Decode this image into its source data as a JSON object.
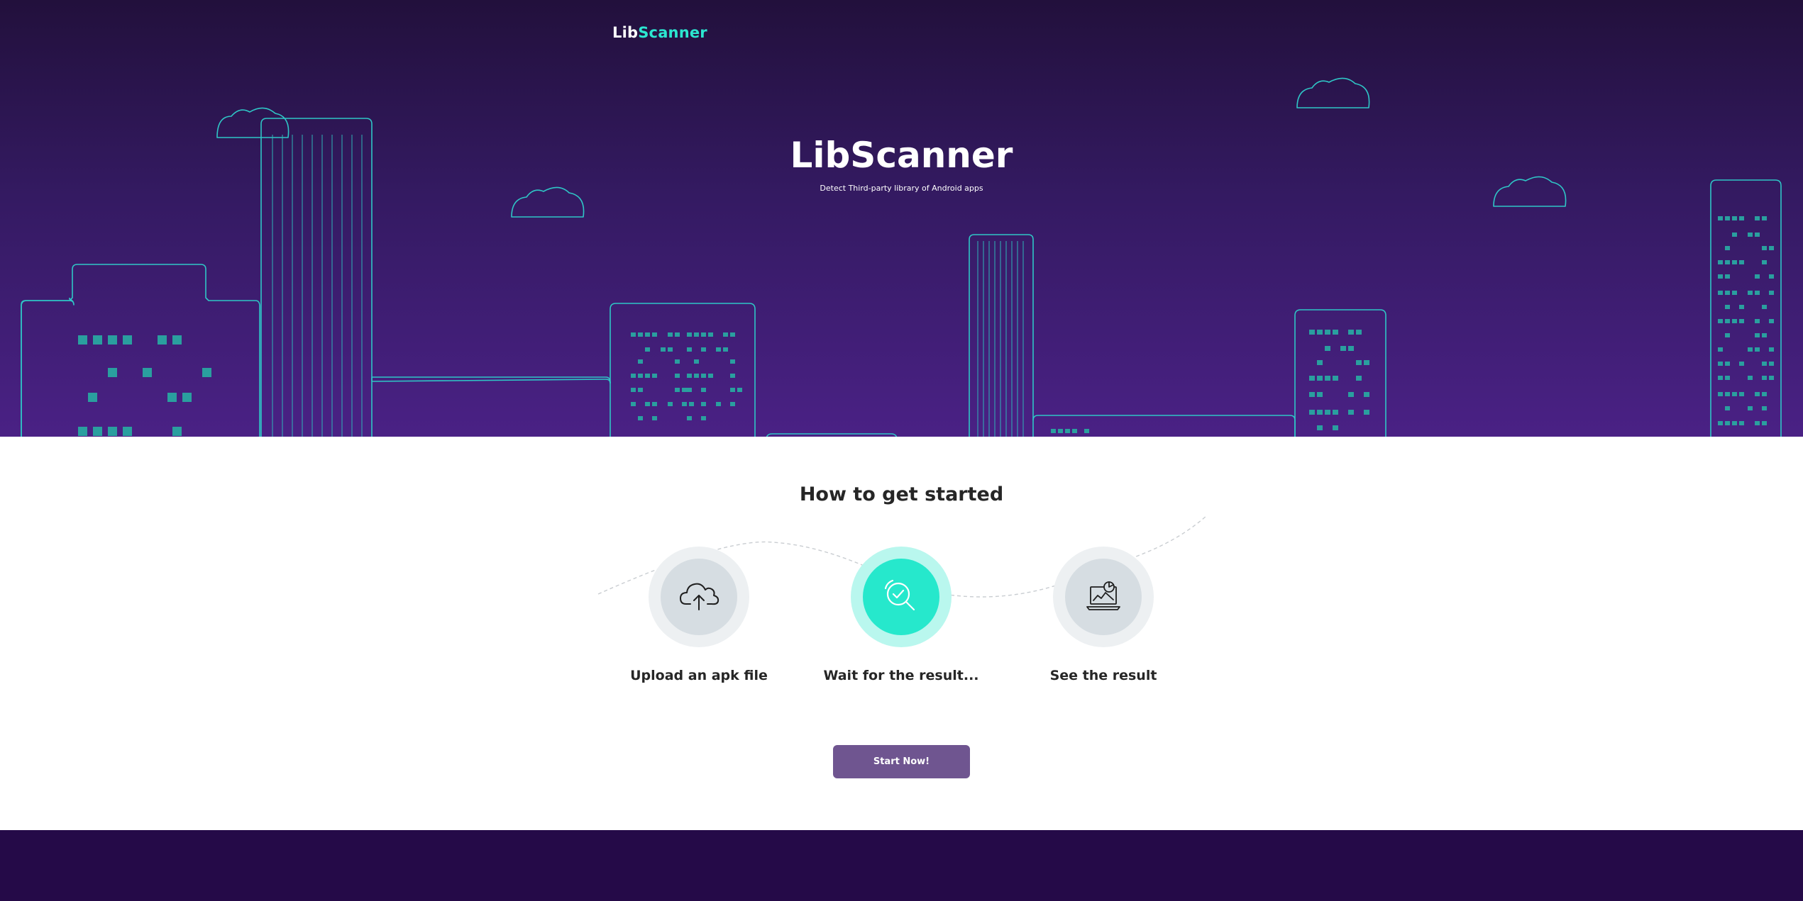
{
  "header": {
    "logo_part1": "Lib",
    "logo_part2": "Scanner"
  },
  "hero": {
    "title": "LibScanner",
    "subtitle": "Detect Third-party library of Android apps"
  },
  "steps": {
    "title": "How to get started",
    "items": [
      {
        "label": "Upload an apk file",
        "icon": "cloud-upload-icon",
        "active": false
      },
      {
        "label": "Wait for the result...",
        "icon": "magnifier-check-icon",
        "active": true
      },
      {
        "label": "See the result",
        "icon": "laptop-chart-icon",
        "active": false
      }
    ]
  },
  "cta": {
    "label": "Start Now!"
  },
  "colors": {
    "hero_top": "#22103c",
    "hero_bottom": "#4a2185",
    "accent": "#2ce6d0",
    "button": "#6f5590",
    "footer": "#250a48"
  }
}
